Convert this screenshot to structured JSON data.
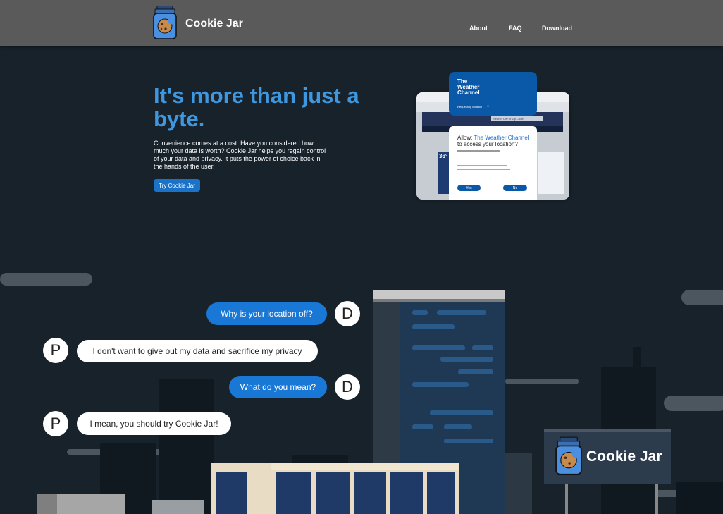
{
  "header": {
    "brand": "Cookie Jar",
    "nav": [
      "About",
      "FAQ",
      "Download"
    ]
  },
  "hero": {
    "title": "It's more than just a byte.",
    "body": "Convenience comes at a cost. Have you considered how much your data is worth? Cookie Jar helps you regain control of your data and privacy. It puts the power of choice back in the hands of the user.",
    "cta": "Try Cookie Jar"
  },
  "preview": {
    "card_title": "The Weather Channel",
    "card_sub": "Requesting location",
    "dialog_prefix": "Allow: ",
    "dialog_app": "The Weather Channel",
    "dialog_rest": "to access your location?",
    "yes": "Yes",
    "no": "No",
    "search_placeholder": "Search City or Zip Code",
    "temp": "36°"
  },
  "chat": [
    {
      "speaker": "D",
      "text": "Why is your location off?"
    },
    {
      "speaker": "P",
      "text": "I don't want to give out my data and sacrifice my privacy"
    },
    {
      "speaker": "D",
      "text": "What do you mean?"
    },
    {
      "speaker": "P",
      "text": "I mean, you should try Cookie Jar!"
    }
  ],
  "billboard": {
    "text": "Cookie Jar"
  },
  "colors": {
    "accent": "#1978d6",
    "title": "#3f97e0",
    "header": "#5a5a5a",
    "background": "#18222b"
  }
}
